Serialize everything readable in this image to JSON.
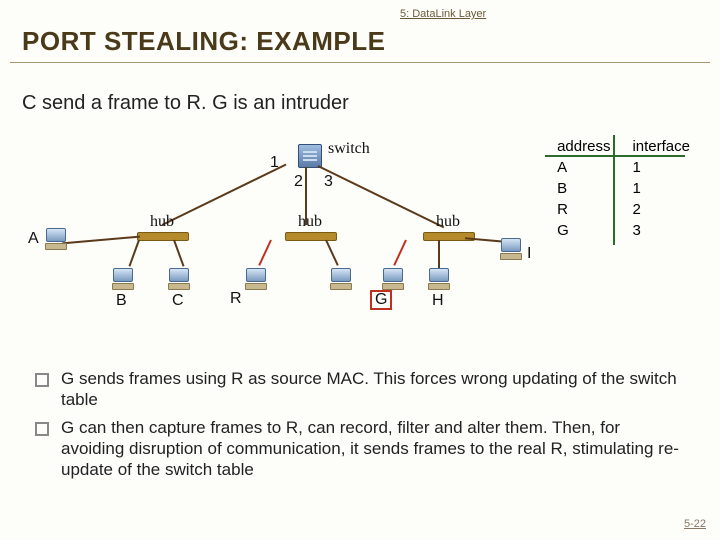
{
  "header": {
    "breadcrumb": "5: DataLink Layer"
  },
  "title": "PORT STEALING: EXAMPLE",
  "subtitle": "C send a frame to R.  G is an intruder",
  "diagram": {
    "switch_label": "switch",
    "ports": {
      "p1": "1",
      "p2": "2",
      "p3": "3"
    },
    "hub_label_left": "hub",
    "hub_label_mid": "hub",
    "hub_label_right": "hub",
    "hosts": {
      "A": "A",
      "B": "B",
      "C": "C",
      "R": "R",
      "G": "G",
      "H": "H",
      "I": "I"
    }
  },
  "table": {
    "col1": "address",
    "col2": "interface",
    "rows": [
      {
        "addr": "A",
        "iface": "1"
      },
      {
        "addr": "B",
        "iface": "1"
      },
      {
        "addr": "R",
        "iface": "2"
      },
      {
        "addr": "G",
        "iface": "3"
      }
    ]
  },
  "bullets": {
    "b1": "G sends frames using R as source MAC. This forces wrong updating of the switch table",
    "b2": "G can then capture frames to R, can record, filter and alter them. Then, for avoiding disruption of communication, it sends frames to the real R, stimulating re-update of the switch table"
  },
  "page": "5-22"
}
